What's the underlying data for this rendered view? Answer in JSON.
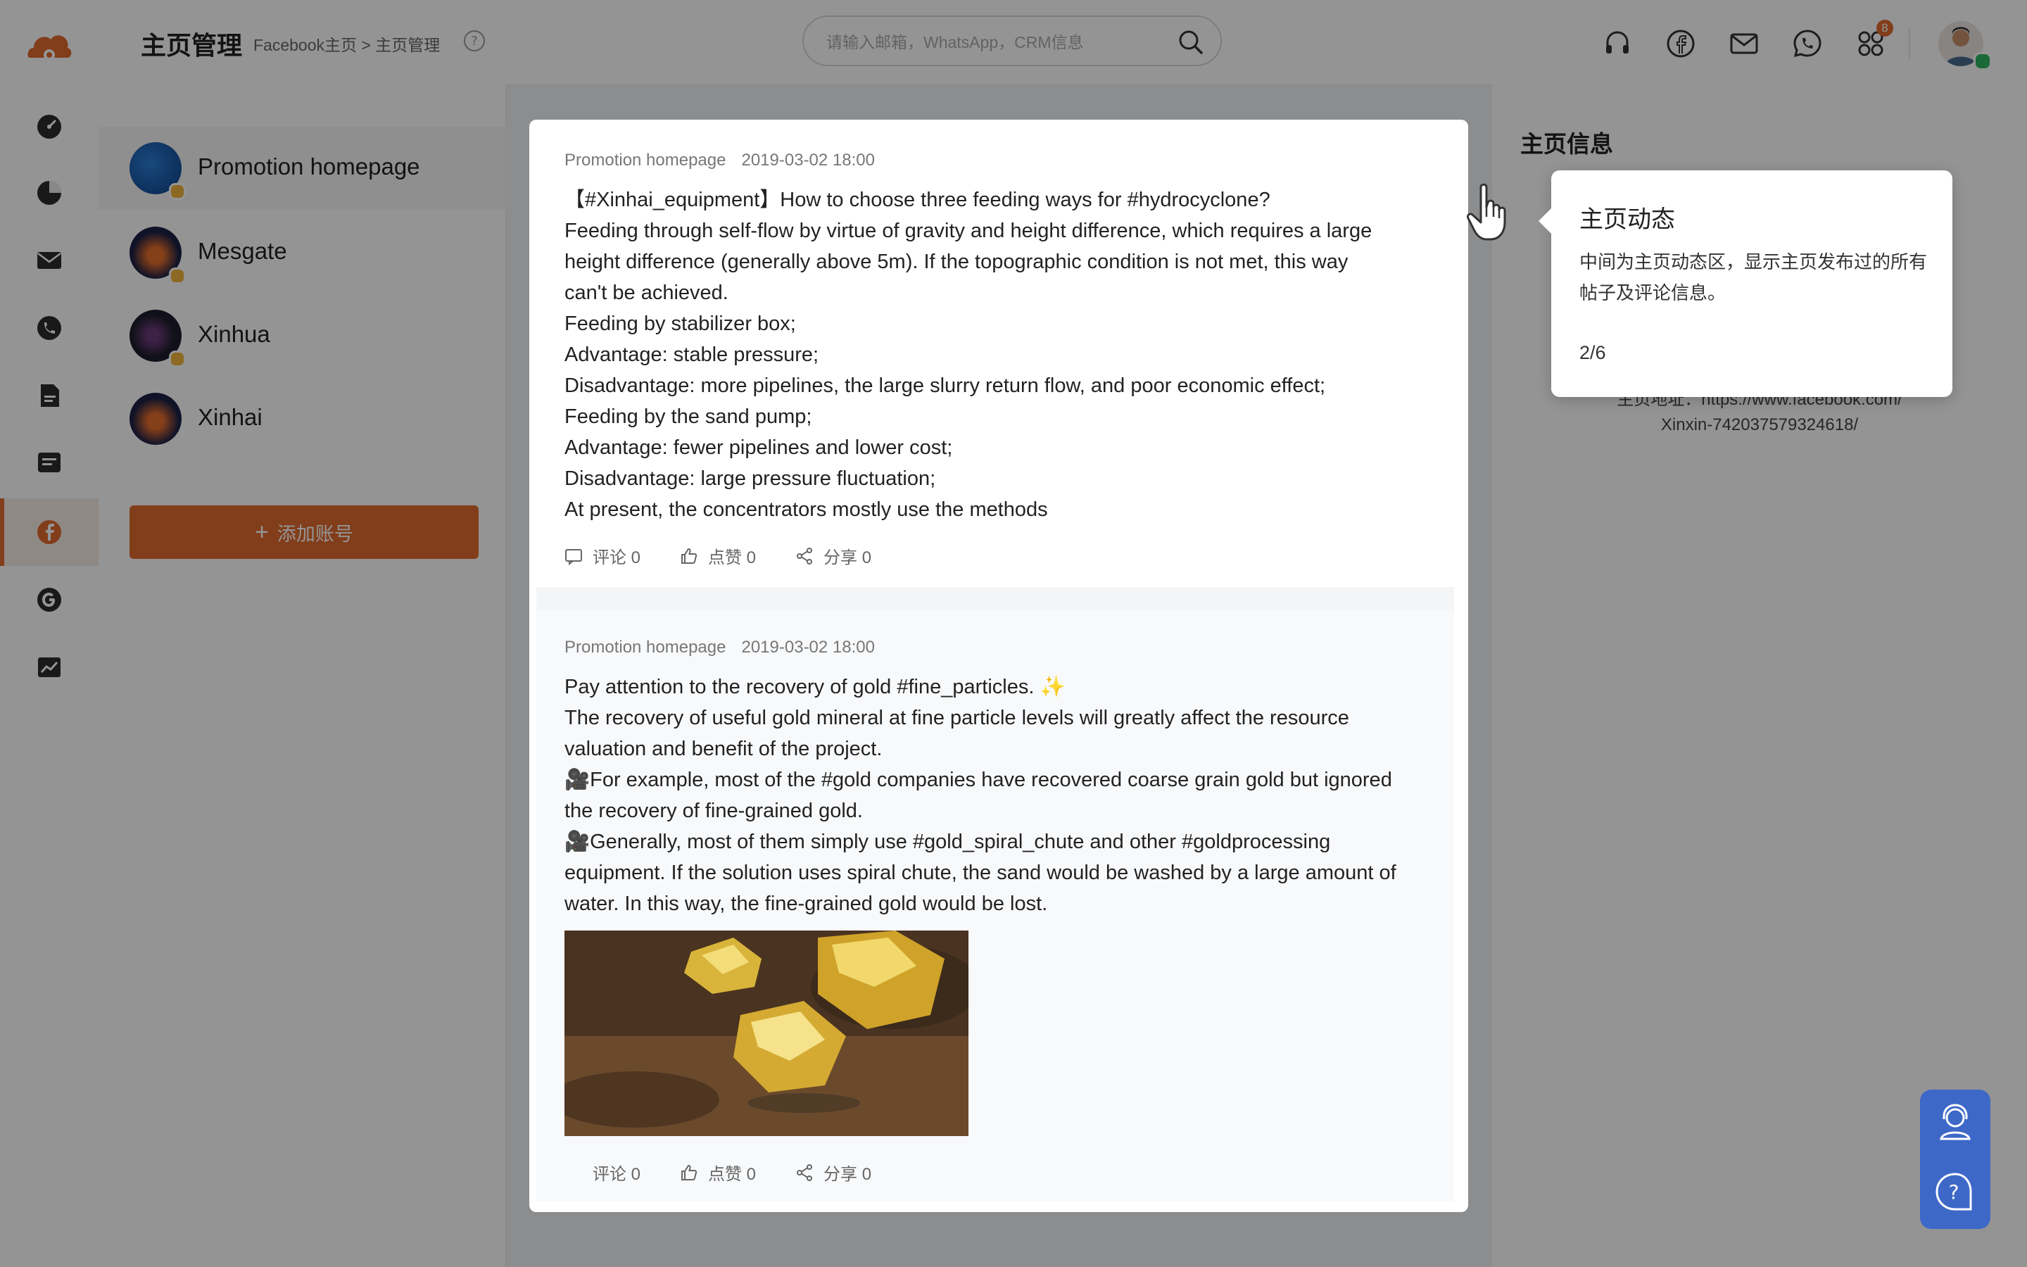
{
  "header": {
    "title": "主页管理",
    "breadcrumb": "Facebook主页 > 主页管理",
    "search_placeholder": "请输入邮箱，WhatsApp，CRM信息",
    "notification_count": "8"
  },
  "rail": {
    "items": [
      "dashboard-icon",
      "chart-icon",
      "mail-icon",
      "phone-icon",
      "file-icon",
      "message-icon",
      "facebook-icon",
      "google-icon",
      "trend-icon"
    ],
    "active": "facebook-icon"
  },
  "accounts": {
    "items": [
      {
        "name": "Promotion homepage"
      },
      {
        "name": "Mesgate"
      },
      {
        "name": "Xinhua"
      },
      {
        "name": "Xinhai"
      }
    ],
    "add_label": "添加账号"
  },
  "posts": [
    {
      "page": "Promotion homepage",
      "date": "2019-03-02 18:00",
      "lines": [
        "【#Xinhai_equipment】How to choose three feeding ways for #hydrocyclone?",
        "Feeding through self-flow by virtue of gravity and height difference, which requires a large",
        "height difference (generally above 5m). If the topographic condition is not met, this way",
        "can't be achieved.",
        "Feeding by stabilizer box;",
        "Advantage: stable pressure;",
        "Disadvantage: more pipelines, the large slurry return flow, and poor economic effect;",
        "Feeding by the sand pump;",
        "Advantage: fewer pipelines and lower cost;",
        "Disadvantage: large pressure fluctuation;",
        "At present, the concentrators mostly use the methods"
      ],
      "comments": "评论 0",
      "likes": "点赞 0",
      "shares": "分享 0"
    },
    {
      "page": "Promotion homepage",
      "date": "2019-03-02 18:00",
      "lines": [
        "Pay attention to the recovery of gold #fine_particles. ✨",
        "The recovery of useful gold mineral at fine particle levels will greatly affect the resource",
        "valuation and benefit of the project.",
        "🎥For example, most of the #gold companies have recovered coarse grain gold but ignored",
        "the recovery of fine-grained gold.",
        "🎥Generally, most of them simply use #gold_spiral_chute and other #goldprocessing",
        "equipment. If the solution uses spiral chute, the sand would be washed by a large amount of",
        "water. In this way, the fine-grained gold would be lost."
      ],
      "comments": "评论 0",
      "likes": "点赞 0",
      "shares": "分享 0"
    }
  ],
  "info": {
    "title": "主页信息",
    "url_line1": "主页地址：https://www.facebook.com/",
    "url_line2": "Xinxin-742037579324618/"
  },
  "tour": {
    "title": "主页动态",
    "body": "中间为主页动态区，显示主页发布过的所有帖子及评论信息。",
    "step": "2/6"
  },
  "colors": {
    "accent": "#e0692d",
    "support_widget": "#3d68c8",
    "online": "#2db55d"
  }
}
